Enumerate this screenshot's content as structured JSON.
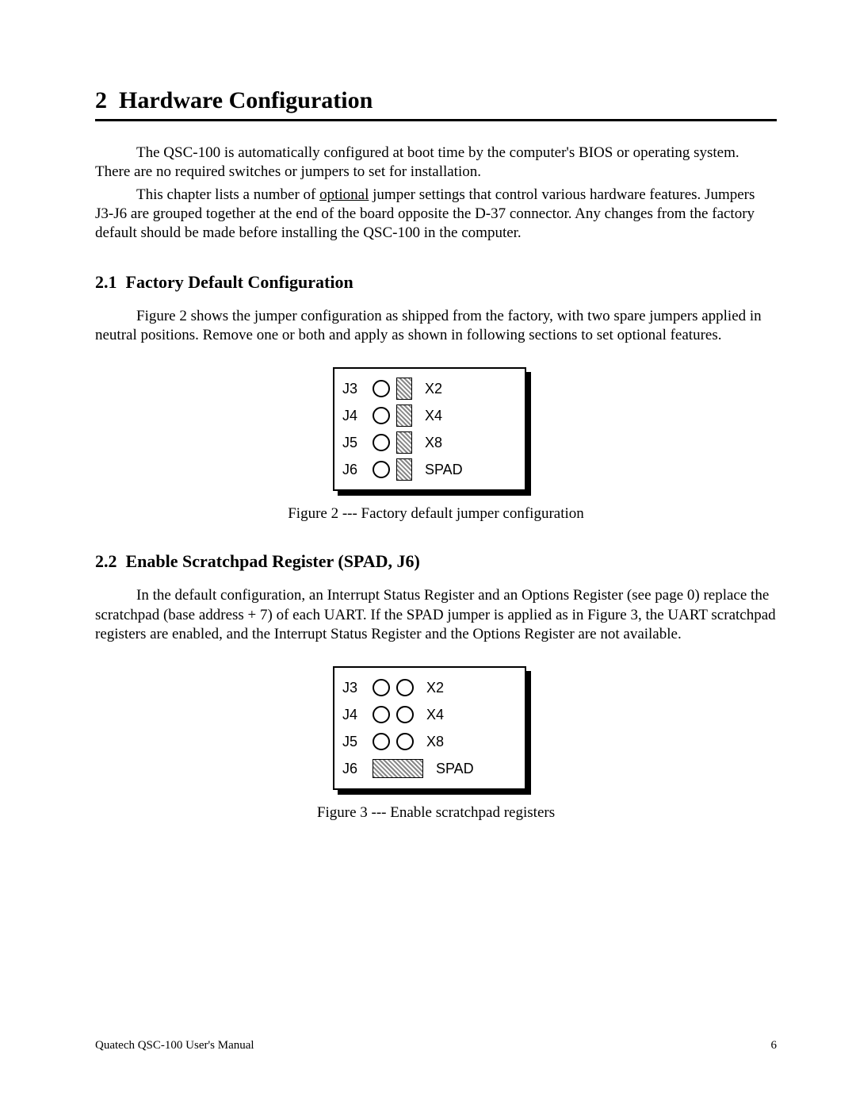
{
  "section": {
    "number": "2",
    "title": "Hardware Configuration"
  },
  "intro": {
    "p1a": "The QSC-100 is automatically configured at boot time by the computer's BIOS or operating system.  There are no required switches or jumpers to set for installation.",
    "p2_pre": "This chapter lists a number of ",
    "p2_underlined": "optional",
    "p2_post": " jumper settings that control various hardware features.  Jumpers J3-J6 are grouped together at the end of the board opposite the D-37 connector.  Any changes from the factory default should be made before installing the QSC-100 in the computer."
  },
  "sub1": {
    "number": "2.1",
    "title": "Factory Default Configuration",
    "body": "Figure 2 shows the jumper configuration as shipped from the factory, with two spare jumpers applied in neutral positions.  Remove one or both and apply as shown in following sections to set optional features."
  },
  "figure2": {
    "rows": [
      {
        "left": "J3",
        "type": "circle-hatch",
        "right": "X2"
      },
      {
        "left": "J4",
        "type": "circle-hatch",
        "right": "X4"
      },
      {
        "left": "J5",
        "type": "circle-hatch",
        "right": "X8"
      },
      {
        "left": "J6",
        "type": "circle-hatch",
        "right": "SPAD"
      }
    ],
    "caption": "Figure 2 --- Factory default jumper configuration"
  },
  "sub2": {
    "number": "2.2",
    "title": "Enable Scratchpad Register (SPAD, J6)",
    "body": "In the default configuration, an Interrupt Status Register and an Options Register (see page 0) replace the scratchpad (base address + 7) of each UART.   If the SPAD jumper is applied as in Figure 3, the UART scratchpad registers are enabled, and the Interrupt Status Register and the Options Register are not available."
  },
  "figure3": {
    "rows": [
      {
        "left": "J3",
        "type": "two-circles",
        "right": "X2"
      },
      {
        "left": "J4",
        "type": "two-circles",
        "right": "X4"
      },
      {
        "left": "J5",
        "type": "two-circles",
        "right": "X8"
      },
      {
        "left": "J6",
        "type": "wide-hatch",
        "right": "SPAD"
      }
    ],
    "caption": "Figure 3 --- Enable scratchpad registers"
  },
  "footer": {
    "left": "Quatech  QSC-100 User's Manual",
    "right": "6"
  }
}
